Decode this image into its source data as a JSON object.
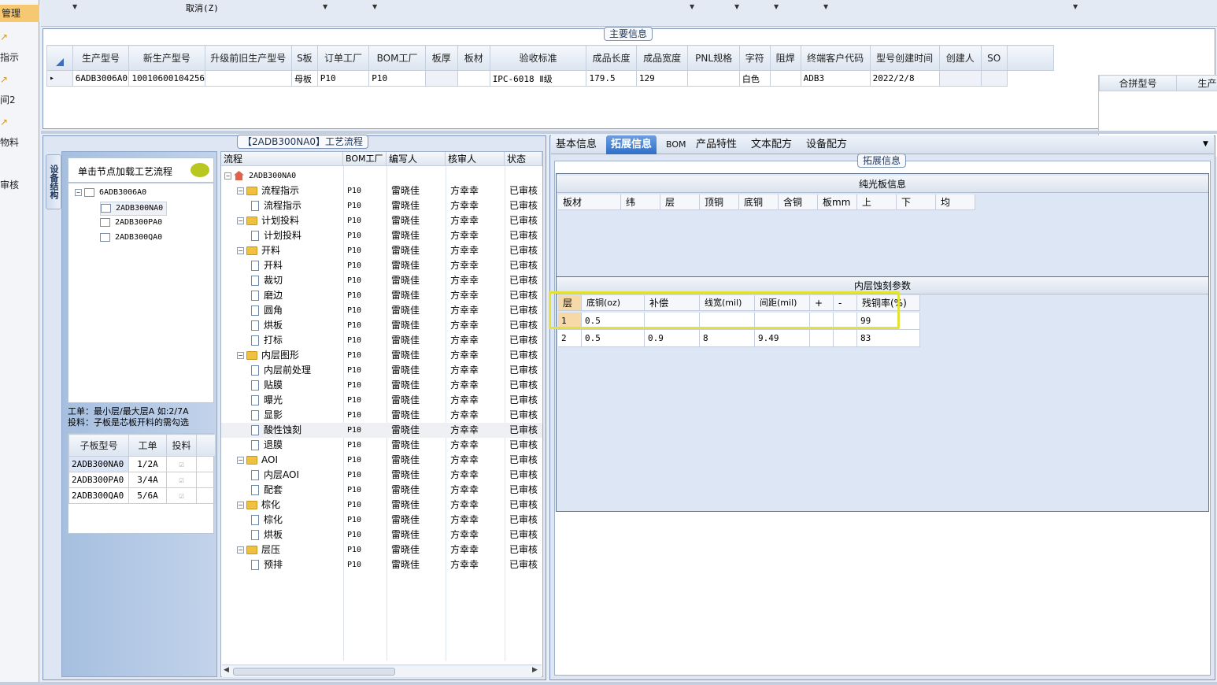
{
  "left_strip": {
    "items": [
      "管理",
      "指示",
      "间2",
      "物料",
      "审核"
    ]
  },
  "toolbar": {
    "cancel_label": "取消(Z)"
  },
  "main_info": {
    "legend": "主要信息",
    "columns": [
      "生产型号",
      "新生产型号",
      "升级前旧生产型号",
      "S板",
      "订单工厂",
      "BOM工厂",
      "板厚",
      "板材",
      "验收标准",
      "成品长度",
      "成品宽度",
      "PNL规格",
      "字符",
      "阻焊",
      "终端客户代码",
      "型号创建时间",
      "创建人",
      "SO"
    ],
    "row": [
      "6ADB3006A0",
      "10010600104256",
      "",
      "母板",
      "P10",
      "P10",
      "",
      "",
      "IPC-6018 Ⅱ级",
      "179.5",
      "129",
      "",
      "白色",
      "",
      "ADB3",
      "2022/2/8",
      "",
      ""
    ]
  },
  "merge_panel": {
    "columns": [
      "合拼型号",
      "生产型号"
    ]
  },
  "process_panel": {
    "legend": "【2ADB300NA0】工艺流程",
    "side_tab": "设备结构",
    "load_hint": "单击节点加载工艺流程",
    "tree": [
      "6ADB3006A0",
      "2ADB300NA0",
      "2ADB300PA0",
      "2ADB300QA0"
    ],
    "hint_line1": "工单：最小层/最大层A 如:2/7A",
    "hint_line2": "投料：子板是芯板开料的需勾选",
    "sub_columns": [
      "子板型号",
      "工单",
      "投料"
    ],
    "sub_rows": [
      {
        "model": "2ADB300NA0",
        "order": "1/2A"
      },
      {
        "model": "2ADB300PA0",
        "order": "3/4A"
      },
      {
        "model": "2ADB300QA0",
        "order": "5/6A"
      }
    ],
    "flow_columns": [
      "流程",
      "BOM工厂",
      "编写人",
      "核审人",
      "状态"
    ],
    "flow_root": "2ADB300NA0",
    "flow_rows": [
      {
        "name": "流程指示",
        "level": 1,
        "type": "folder"
      },
      {
        "name": "流程指示",
        "level": 2,
        "type": "doc"
      },
      {
        "name": "计划投料",
        "level": 1,
        "type": "folder"
      },
      {
        "name": "计划投料",
        "level": 2,
        "type": "doc"
      },
      {
        "name": "开料",
        "level": 1,
        "type": "folder"
      },
      {
        "name": "开料",
        "level": 2,
        "type": "doc"
      },
      {
        "name": "裁切",
        "level": 2,
        "type": "doc"
      },
      {
        "name": "磨边",
        "level": 2,
        "type": "doc"
      },
      {
        "name": "圆角",
        "level": 2,
        "type": "doc"
      },
      {
        "name": "烘板",
        "level": 2,
        "type": "doc"
      },
      {
        "name": "打标",
        "level": 2,
        "type": "doc"
      },
      {
        "name": "内层图形",
        "level": 1,
        "type": "folder"
      },
      {
        "name": "内层前处理",
        "level": 2,
        "type": "doc"
      },
      {
        "name": "贴膜",
        "level": 2,
        "type": "doc"
      },
      {
        "name": "曝光",
        "level": 2,
        "type": "doc"
      },
      {
        "name": "显影",
        "level": 2,
        "type": "doc"
      },
      {
        "name": "酸性蚀刻",
        "level": 2,
        "type": "doc",
        "selected": true
      },
      {
        "name": "退膜",
        "level": 2,
        "type": "doc"
      },
      {
        "name": "AOI",
        "level": 1,
        "type": "folder"
      },
      {
        "name": "内层AOI",
        "level": 2,
        "type": "doc"
      },
      {
        "name": "配套",
        "level": 2,
        "type": "doc"
      },
      {
        "name": "棕化",
        "level": 1,
        "type": "folder"
      },
      {
        "name": "棕化",
        "level": 2,
        "type": "doc"
      },
      {
        "name": "烘板",
        "level": 2,
        "type": "doc"
      },
      {
        "name": "层压",
        "level": 1,
        "type": "folder"
      },
      {
        "name": "预排",
        "level": 2,
        "type": "doc"
      }
    ],
    "flow_factory": "P10",
    "flow_writer": "雷晓佳",
    "flow_reviewer": "方幸幸",
    "flow_status": "已审核"
  },
  "tabs": [
    "基本信息",
    "拓展信息",
    "BOM",
    "产品特性",
    "文本配方",
    "设备配方"
  ],
  "ext": {
    "legend": "拓展信息",
    "sec1_title": "纯光板信息",
    "sec1_columns": [
      "板材",
      "纬",
      "层",
      "顶铜",
      "底铜",
      "含铜",
      "板mm",
      "上",
      "下",
      "均"
    ],
    "sec2_title": "内层蚀刻参数",
    "sec2_columns": [
      "层",
      "底铜(oz)",
      "补偿",
      "线宽(mil)",
      "间距(mil)",
      "+",
      "-",
      "残铜率(%)"
    ],
    "sec2_rows": [
      [
        "1",
        "0.5",
        "",
        "",
        "",
        "",
        "",
        "99"
      ],
      [
        "2",
        "0.5",
        "0.9",
        "8",
        "9.49",
        "",
        "",
        "83"
      ]
    ]
  },
  "colors": {
    "accent": "#2f6fc6",
    "highlight": "#e2e23a",
    "folder": "#f0c040"
  }
}
